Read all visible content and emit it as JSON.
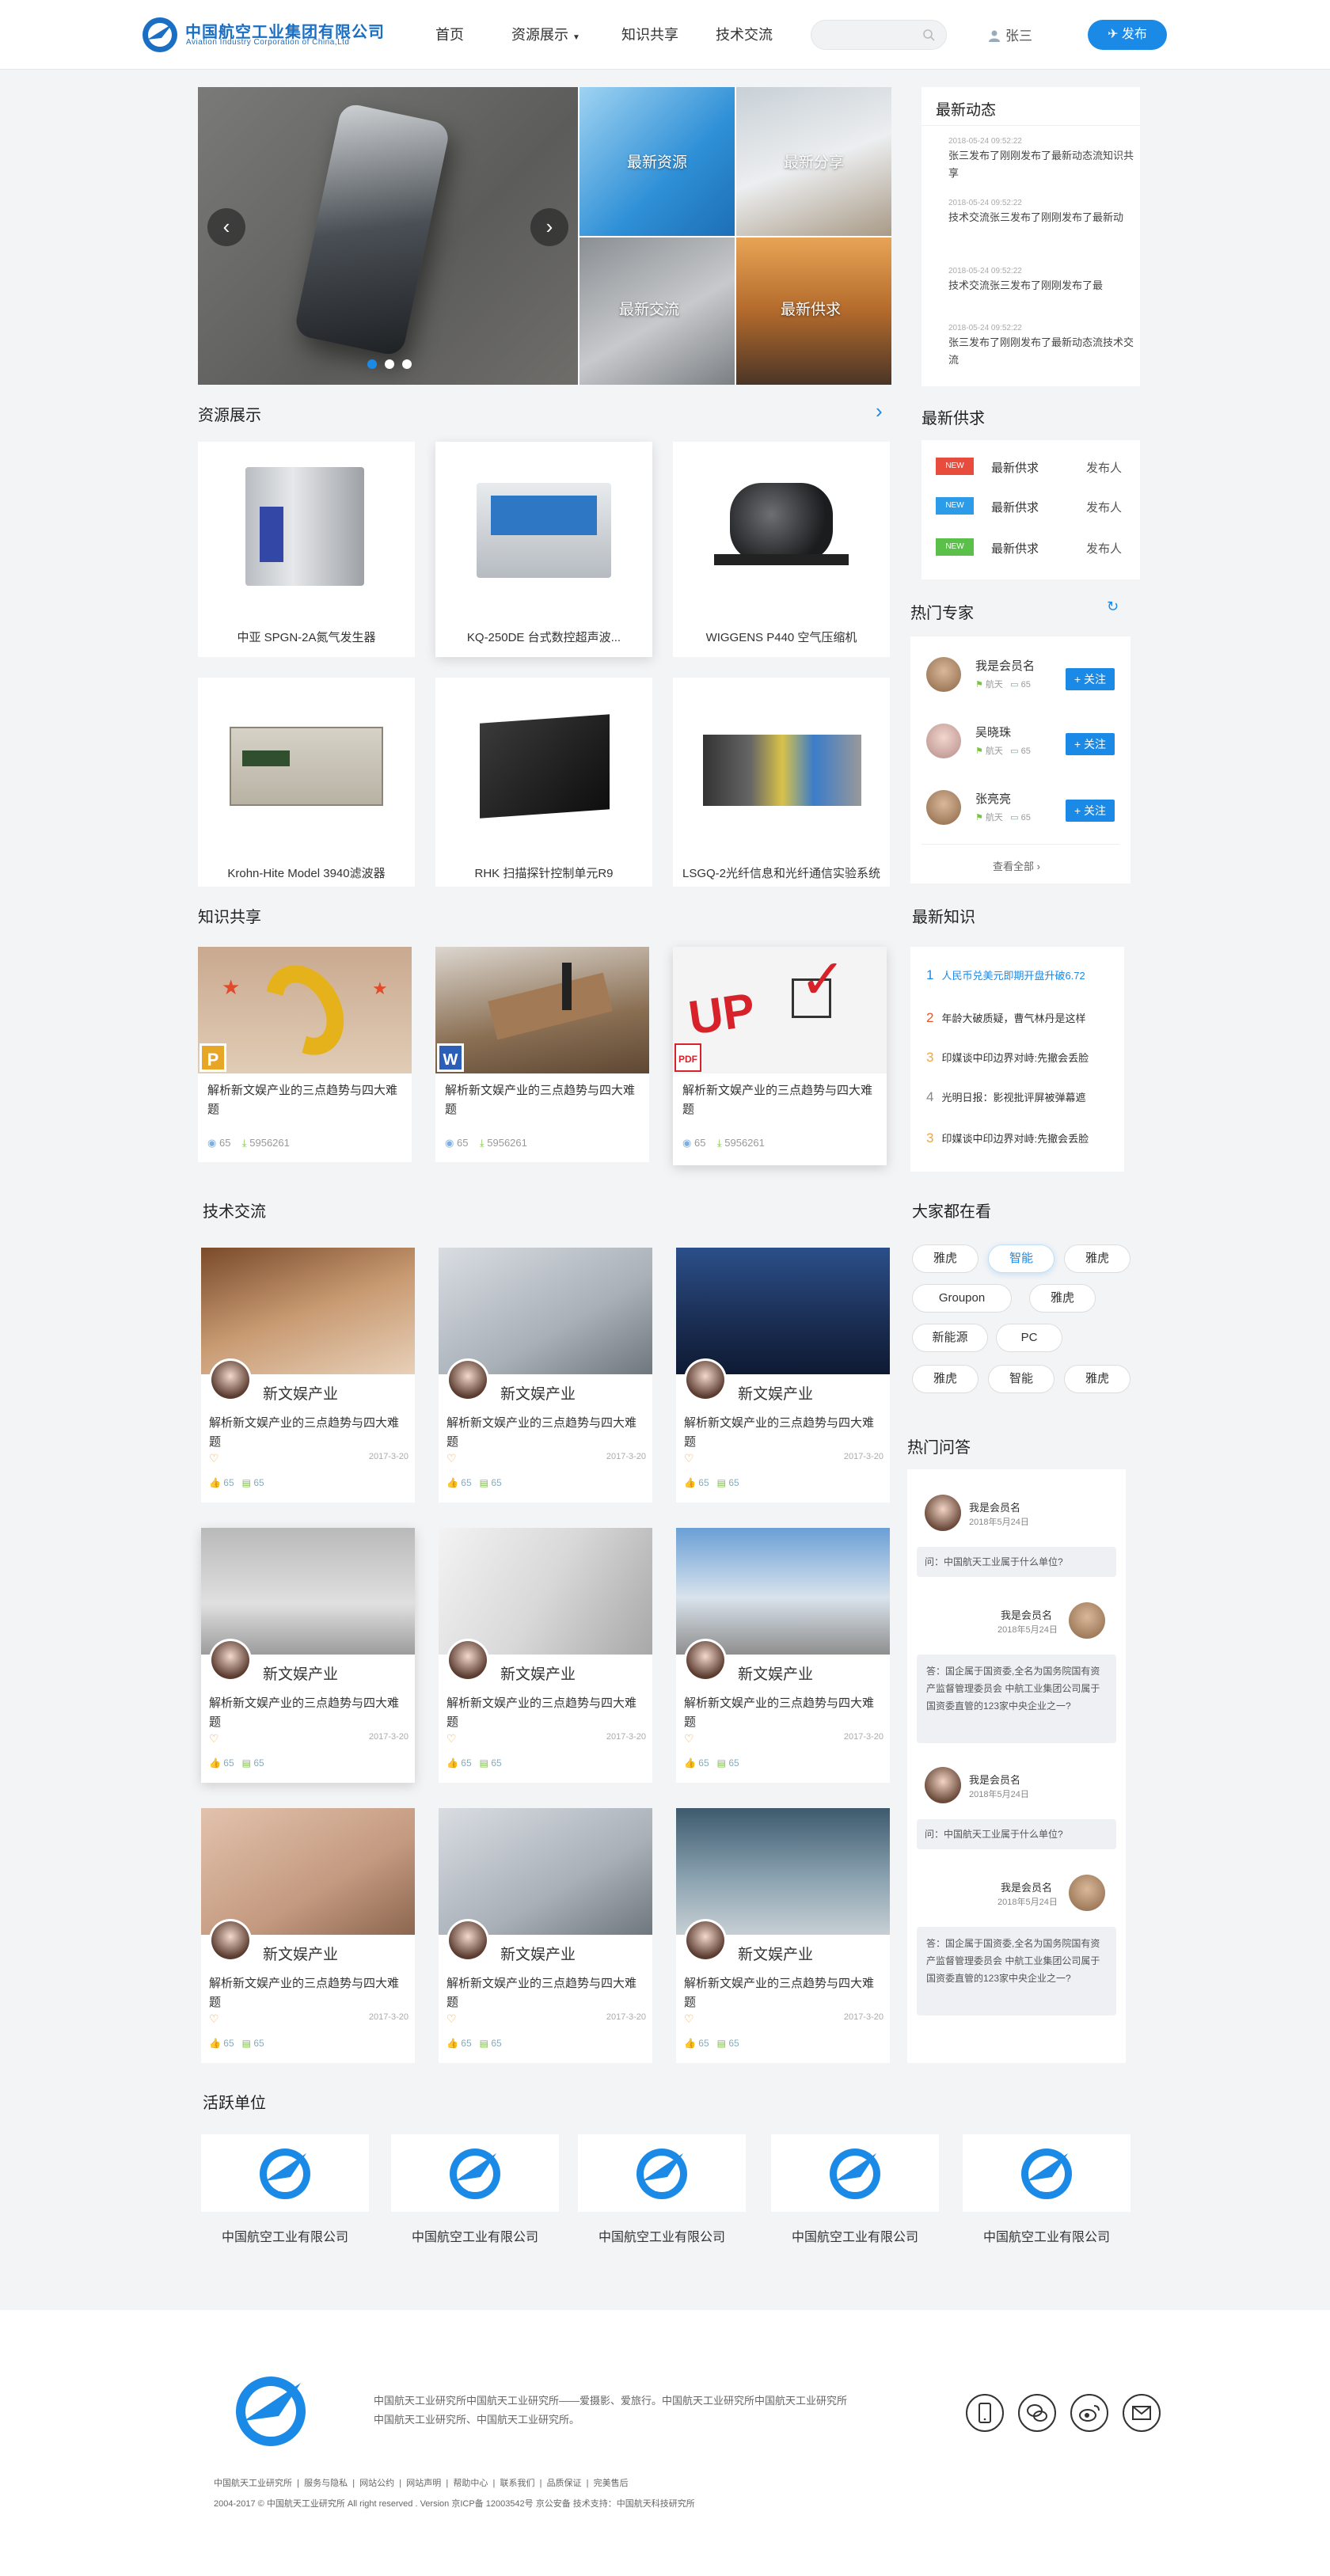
{
  "header": {
    "logo_cn": "中国航空工业集团有限公司",
    "logo_en": "Aviation Industry Corporation of China,Ltd",
    "nav": [
      "首页",
      "资源展示",
      "知识共享",
      "技术交流"
    ],
    "search_placeholder": "",
    "user": "张三",
    "publish": "发布"
  },
  "banner": {
    "tiles": [
      "最新资源",
      "最新分享",
      "最新交流",
      "最新供求"
    ]
  },
  "latest_news": {
    "title": "最新动态",
    "items": [
      {
        "time": "2018-05-24 09:52:22",
        "text": "张三发布了刚刚发布了最新动态流知识共享"
      },
      {
        "time": "2018-05-24 09:52:22",
        "text": "技术交流张三发布了刚刚发布了最新动"
      },
      {
        "time": "2018-05-24 09:52:22",
        "text": "技术交流张三发布了刚刚发布了最"
      },
      {
        "time": "2018-05-24 09:52:22",
        "text": "张三发布了刚刚发布了最新动态流技术交流"
      }
    ]
  },
  "resources": {
    "title": "资源展示",
    "items": [
      "中亚 SPGN-2A氮气发生器",
      "KQ-250DE 台式数控超声波...",
      "WIGGENS P440 空气压缩机",
      "Krohn-Hite Model 3940滤波器",
      "RHK 扫描探针控制单元R9",
      "LSGQ-2光纤信息和光纤通信实验系统"
    ]
  },
  "supply": {
    "title": "最新供求",
    "badge": "NEW",
    "badge_colors": [
      "#e84c3d",
      "#2c9be8",
      "#5bc04a"
    ],
    "items": [
      {
        "text": "最新供求",
        "right": "发布人"
      },
      {
        "text": "最新供求",
        "right": "发布人"
      },
      {
        "text": "最新供求",
        "right": "发布人"
      }
    ]
  },
  "experts": {
    "title": "热门专家",
    "items": [
      {
        "name": "我是会员名",
        "tag": "航天",
        "count": "65",
        "button": "+ 关注"
      },
      {
        "name": "吴晓珠",
        "tag": "航天",
        "count": "65",
        "button": "+ 关注"
      },
      {
        "name": "张亮亮",
        "tag": "航天",
        "count": "65",
        "button": "+ 关注"
      }
    ],
    "view_all": "查看全部"
  },
  "knowledge": {
    "title": "知识共享",
    "items": [
      {
        "text": "解析新文娱产业的三点趋势与四大难题",
        "views": "65",
        "downloads": "5956261",
        "type": "P"
      },
      {
        "text": "解析新文娱产业的三点趋势与四大难题",
        "views": "65",
        "downloads": "5956261",
        "type": "W"
      },
      {
        "text": "解析新文娱产业的三点趋势与四大难题",
        "views": "65",
        "downloads": "5956261",
        "type": "PDF"
      }
    ]
  },
  "latest_knowledge": {
    "title": "最新知识",
    "items": [
      {
        "num": "1",
        "text": "人民币兑美元即期开盘升破6.72"
      },
      {
        "num": "2",
        "text": "年龄大破质疑，曹气林丹是这样"
      },
      {
        "num": "3",
        "text": "印媒谈中印边界对峙:先撤会丢脸"
      },
      {
        "num": "4",
        "text": "光明日报：影视批评屏被弹幕遮"
      },
      {
        "num": "3",
        "text": "印媒谈中印边界对峙:先撤会丢脸"
      }
    ]
  },
  "tech": {
    "title": "技术交流",
    "items": [
      {
        "name": "新文娱产业",
        "text": "解析新文娱产业的三点趋势与四大难题",
        "date": "2017-3-20",
        "likes": "65",
        "comments": "65"
      },
      {
        "name": "新文娱产业",
        "text": "解析新文娱产业的三点趋势与四大难题",
        "date": "2017-3-20",
        "likes": "65",
        "comments": "65"
      },
      {
        "name": "新文娱产业",
        "text": "解析新文娱产业的三点趋势与四大难题",
        "date": "2017-3-20",
        "likes": "65",
        "comments": "65"
      },
      {
        "name": "新文娱产业",
        "text": "解析新文娱产业的三点趋势与四大难题",
        "date": "2017-3-20",
        "likes": "65",
        "comments": "65"
      },
      {
        "name": "新文娱产业",
        "text": "解析新文娱产业的三点趋势与四大难题",
        "date": "2017-3-20",
        "likes": "65",
        "comments": "65"
      },
      {
        "name": "新文娱产业",
        "text": "解析新文娱产业的三点趋势与四大难题",
        "date": "2017-3-20",
        "likes": "65",
        "comments": "65"
      },
      {
        "name": "新文娱产业",
        "text": "解析新文娱产业的三点趋势与四大难题",
        "date": "2017-3-20",
        "likes": "65",
        "comments": "65"
      },
      {
        "name": "新文娱产业",
        "text": "解析新文娱产业的三点趋势与四大难题",
        "date": "2017-3-20",
        "likes": "65",
        "comments": "65"
      },
      {
        "name": "新文娱产业",
        "text": "解析新文娱产业的三点趋势与四大难题",
        "date": "2017-3-20",
        "likes": "65",
        "comments": "65"
      }
    ]
  },
  "watching": {
    "title": "大家都在看",
    "tags": [
      "雅虎",
      "智能",
      "雅虎",
      "Groupon",
      "雅虎",
      "新能源",
      "PC",
      "雅虎",
      "智能",
      "雅虎"
    ]
  },
  "qa": {
    "title": "热门问答",
    "blocks": [
      {
        "asker": "我是会员名",
        "ask_date": "2018年5月24日",
        "question": "问：中国航天工业属于什么单位?",
        "answerer": "我是会员名",
        "answer_date": "2018年5月24日",
        "answer": "答：国企属于国资委,全名为国务院国有资产监督管理委员会 中航工业集团公司属于国资委直管的123家中央企业之一?"
      },
      {
        "asker": "我是会员名",
        "ask_date": "2018年5月24日",
        "question": "问：中国航天工业属于什么单位?",
        "answerer": "我是会员名",
        "answer_date": "2018年5月24日",
        "answer": "答：国企属于国资委,全名为国务院国有资产监督管理委员会 中航工业集团公司属于国资委直管的123家中央企业之一?"
      }
    ]
  },
  "orgs": {
    "title": "活跃单位",
    "logo_text": "AVIC",
    "items": [
      "中国航空工业有限公司",
      "中国航空工业有限公司",
      "中国航空工业有限公司",
      "中国航空工业有限公司",
      "中国航空工业有限公司"
    ]
  },
  "footer": {
    "logo_text": "AVIC",
    "desc_line1": "中国航天工业研究所中国航天工业研究所——爱摄影、爱旅行。中国航天工业研究所中国航天工业研究所",
    "desc_line2": "中国航天工业研究所、中国航天工业研究所。",
    "links": [
      "中国航天工业研究所",
      "服务与隐私",
      "网站公约",
      "网站声明",
      "帮助中心",
      "联系我们",
      "品质保证",
      "完美售后"
    ],
    "copyright": "2004-2017 © 中国航天工业研究所  All right reserved . Version    京ICP备 12003542号 京公安备    技术支持：中国航天科技研究所",
    "icons": [
      "phone-icon",
      "wechat-icon",
      "weibo-icon",
      "mail-icon"
    ]
  }
}
